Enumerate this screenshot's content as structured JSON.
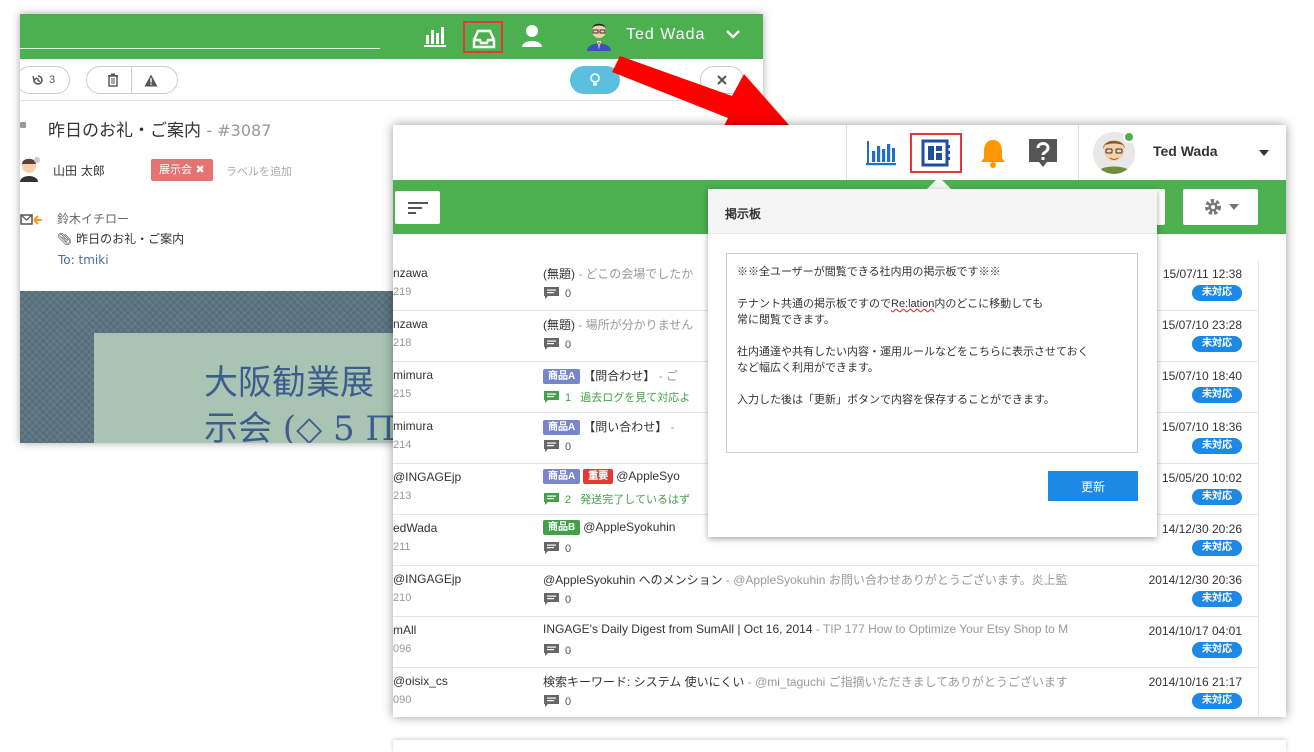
{
  "back_window": {
    "username": "Ted Wada",
    "history_count": "3",
    "subject": "昨日のお礼・ご案内",
    "ticket_number": "- #3087",
    "assignee": "山田 太郎",
    "label": "展示会 ✖",
    "add_label": "ラベルを追加",
    "from": "鈴木イチロー",
    "attachment_subject": "昨日のお礼・ご案内",
    "to_prefix": "To:",
    "to_value": "tmiki",
    "image_text_line1": "大阪勧業展",
    "image_text_line2": "示会 (◇ 5 ППП"
  },
  "front_window": {
    "username": "Ted Wada",
    "popover": {
      "title": "掲示板",
      "line1": "※※全ユーザーが閲覧できる社内用の掲示板です※※",
      "line2a": "テナント共通の掲示板ですので",
      "line2_spell": "Re:lation",
      "line2b": "内のどこに移動しても",
      "line3": "常に閲覧できます。",
      "line4": "社内通達や共有したい内容・運用ルールなどをこちらに表示させておく",
      "line5": "など幅広く利用ができます。",
      "line6": "入力した後は「更新」ボタンで内容を保存することができます。",
      "update_button": "更新"
    },
    "rows": [
      {
        "user": "nzawa",
        "id": "219",
        "tags": [],
        "subject": "(無題)",
        "snippet": " - どこの会場でしたか",
        "comments": "0",
        "comment_text": "",
        "date": "15/07/11 12:38",
        "status": "未対応"
      },
      {
        "user": "nzawa",
        "id": "218",
        "tags": [],
        "subject": "(無題)",
        "snippet": " - 場所が分かりません",
        "comments": "0",
        "comment_text": "",
        "date": "15/07/10 23:28",
        "status": "未対応"
      },
      {
        "user": "mimura",
        "id": "215",
        "tags": [
          {
            "text": "商品A",
            "color": "blue"
          }
        ],
        "subject": "【問合わせ】",
        "snippet": " - ご",
        "comments": "1",
        "comment_text": "過去ログを見て対応よ",
        "date": "15/07/10 18:40",
        "status": "未対応"
      },
      {
        "user": "mimura",
        "id": "214",
        "tags": [
          {
            "text": "商品A",
            "color": "blue"
          }
        ],
        "subject": "【問い合わせ】",
        "snippet": " -",
        "comments": "0",
        "comment_text": "",
        "date": "15/07/10 18:36",
        "status": "未対応"
      },
      {
        "user": "@INGAGEjp",
        "id": "213",
        "tags": [
          {
            "text": "商品A",
            "color": "blue"
          },
          {
            "text": "重要",
            "color": "red"
          }
        ],
        "subject": "@AppleSyo",
        "snippet": "",
        "comments": "2",
        "comment_text": "発送完了しているはず",
        "date": "15/05/20 10:02",
        "status": "未対応"
      },
      {
        "user": "edWada",
        "id": "211",
        "tags": [
          {
            "text": "商品B",
            "color": "green"
          }
        ],
        "subject": "@AppleSyokuhin",
        "snippet": " ",
        "comments": "0",
        "comment_text": "",
        "date": "14/12/30 20:26",
        "status": "未対応"
      },
      {
        "user": "@INGAGEjp",
        "id": "210",
        "tags": [],
        "subject": "@AppleSyokuhin へのメンション",
        "snippet": " - @AppleSyokuhin お問い合わせありがとうございます。炎上監",
        "comments": "0",
        "comment_text": "",
        "date": "2014/12/30 20:36",
        "status": "未対応"
      },
      {
        "user": "mAll",
        "id": "096",
        "tags": [],
        "subject": "INGAGE's Daily Digest from SumAll | Oct 16, 2014",
        "snippet": " - TIP 177 How to Optimize Your Etsy Shop to M",
        "comments": "0",
        "comment_text": "",
        "date": "2014/10/17 04:01",
        "status": "未対応"
      },
      {
        "user": "@oisix_cs",
        "id": "090",
        "tags": [],
        "subject": "検索キーワード: システム 使いにくい",
        "snippet": " - @mi_taguchi ご指摘いただきましてありがとうございます",
        "comments": "0",
        "comment_text": "",
        "date": "2014/10/16 21:17",
        "status": "未対応"
      }
    ]
  },
  "colors": {
    "green": "#4caf50",
    "highlight_red": "#e53935",
    "status_blue": "#1e88e5",
    "tag_blue": "#7986cb"
  }
}
